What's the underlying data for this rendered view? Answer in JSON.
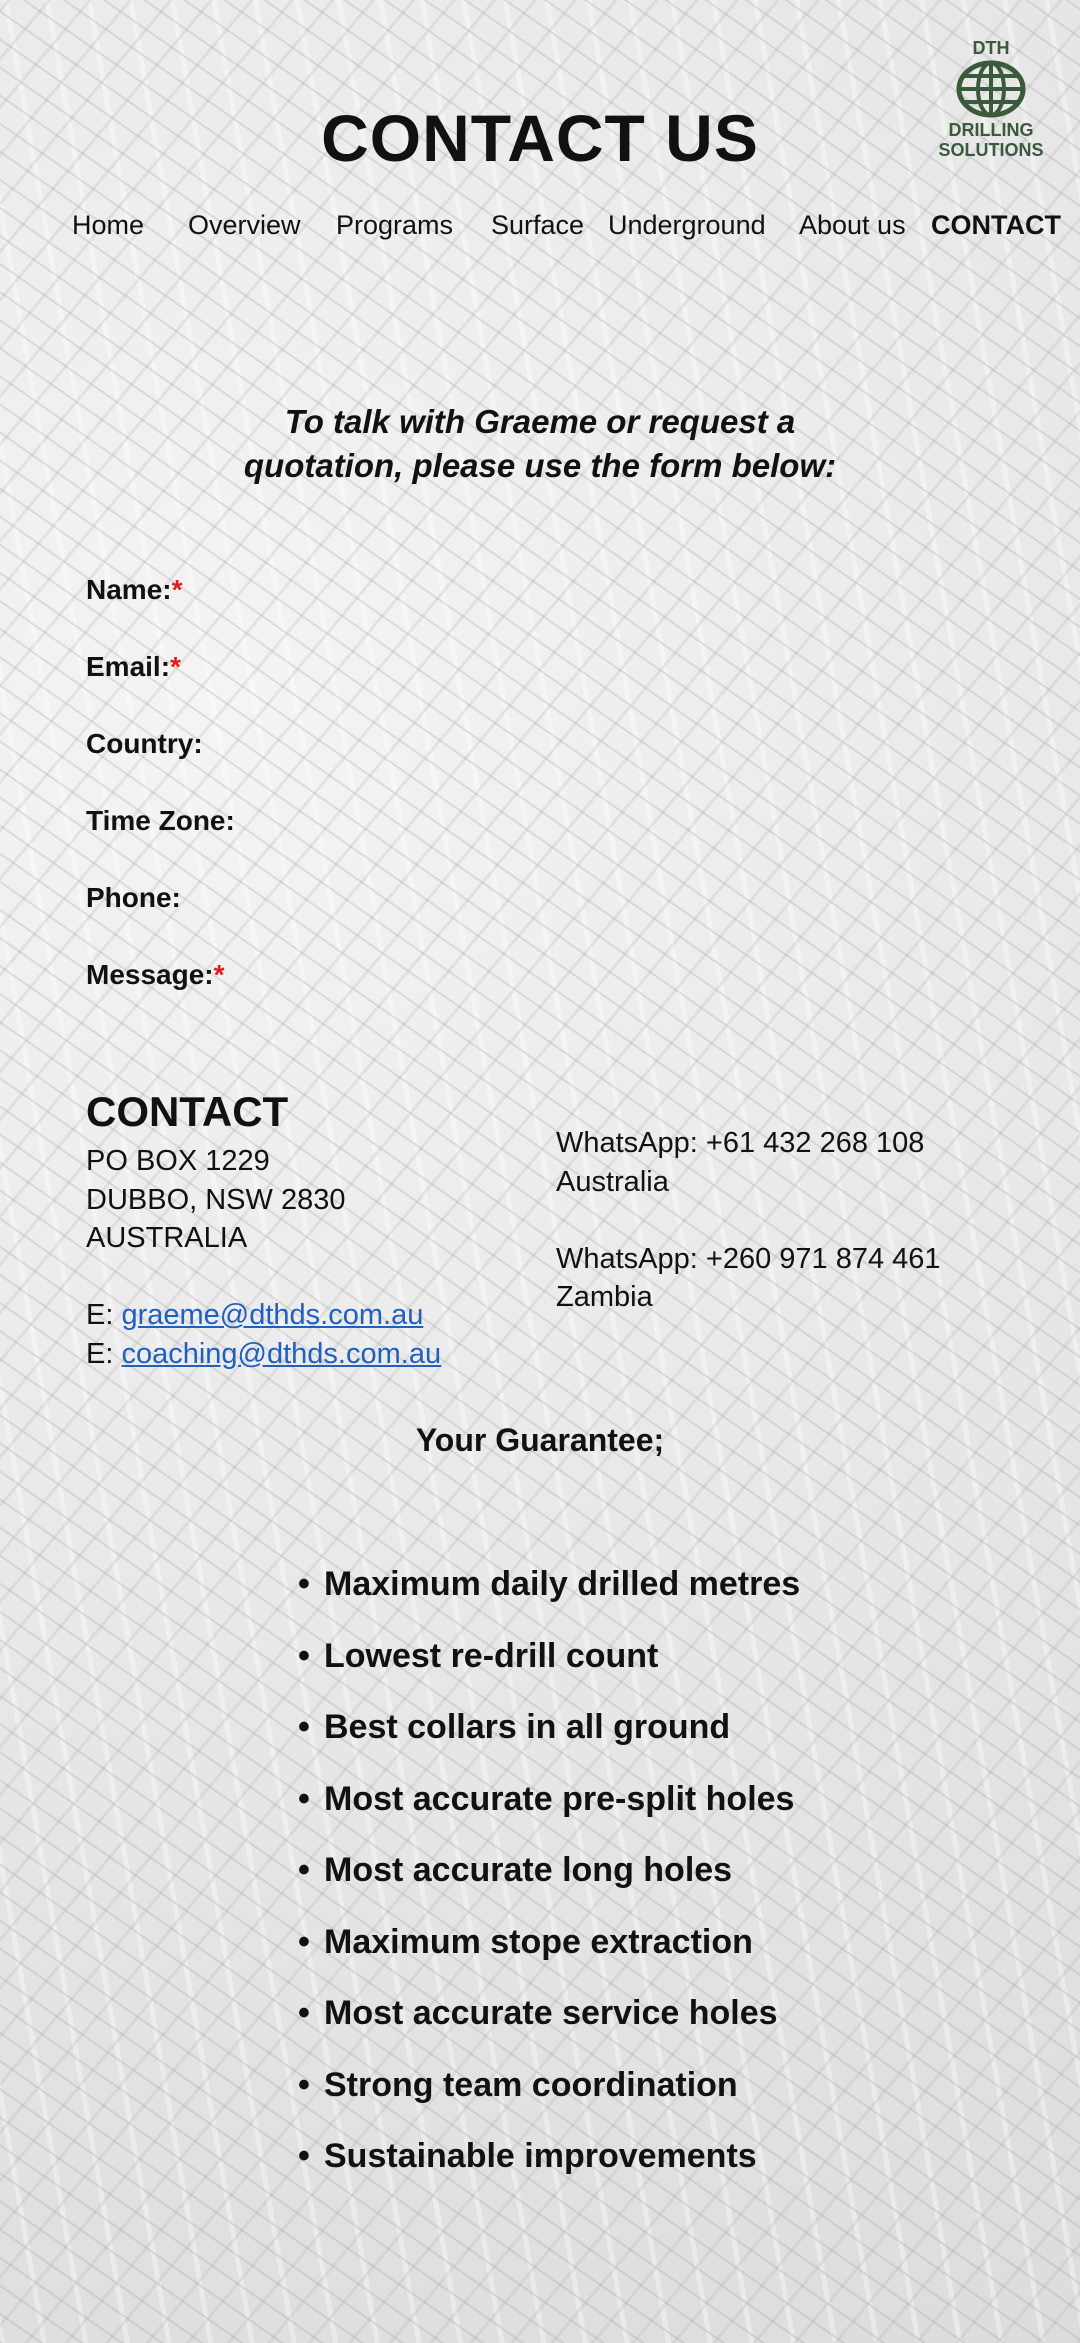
{
  "header": {
    "title": "CONTACT US",
    "logo": {
      "top": "DTH",
      "line1": "DRILLING",
      "line2": "SOLUTIONS",
      "color": "#3b5a3b"
    }
  },
  "nav": {
    "items": [
      {
        "label": "Home"
      },
      {
        "label": "Overview"
      },
      {
        "label": "Programs"
      },
      {
        "label": "Surface"
      },
      {
        "label": "Underground"
      },
      {
        "label": "About us"
      },
      {
        "label": "CONTACT",
        "active": true
      }
    ]
  },
  "intro": {
    "line1": "To talk with Graeme or request a",
    "line2": "quotation, please use the form below:"
  },
  "form": {
    "required_mark": "*",
    "fields": [
      {
        "label": "Name:",
        "required": true
      },
      {
        "label": "Email:",
        "required": true
      },
      {
        "label": "Country:",
        "required": false
      },
      {
        "label": "Time Zone:",
        "required": false
      },
      {
        "label": "Phone:",
        "required": false
      },
      {
        "label": "Message:",
        "required": true
      }
    ]
  },
  "contact": {
    "heading": "CONTACT",
    "address": [
      "PO BOX 1229",
      "DUBBO, NSW 2830",
      "AUSTRALIA"
    ],
    "email_prefix": "E: ",
    "emails": [
      "graeme@dthds.com.au",
      "coaching@dthds.com.au"
    ],
    "whatsapp": [
      {
        "number": "WhatsApp: +61 432 268 108",
        "country": "Australia"
      },
      {
        "number": "WhatsApp: +260 971 874 461",
        "country": "Zambia"
      }
    ]
  },
  "guarantee": {
    "heading": "Your Guarantee;",
    "bullet": "•",
    "items": [
      "Maximum daily drilled metres",
      "Lowest re-drill count",
      "Best collars in all ground",
      "Most accurate pre-split holes",
      "Most accurate long holes",
      "Maximum stope extraction",
      "Most accurate service holes",
      "Strong team coordination",
      "Sustainable improvements"
    ]
  },
  "colors": {
    "required": "#e31b1b",
    "link": "#1f5fbf",
    "logo": "#3b5a3b"
  }
}
